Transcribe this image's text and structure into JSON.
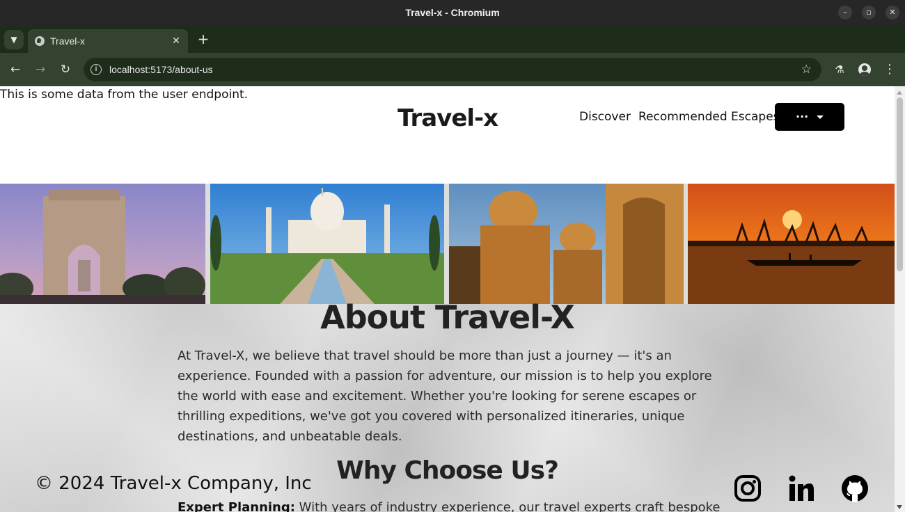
{
  "browser": {
    "window_title": "Travel-x - Chromium",
    "tab_title": "Travel-x",
    "url": "localhost:5173/about-us",
    "controls": {
      "minimize": "–",
      "maximize": "▫",
      "close": "✕",
      "tab_close": "✕",
      "new_tab": "+"
    }
  },
  "page": {
    "user_data": "This is some data from the user endpoint.",
    "logo": "Travel-x",
    "nav": {
      "discover": "Discover",
      "recommended": "Recommended Escapes",
      "more_button": "···"
    },
    "gallery": [
      {
        "name": "india-gate-photo"
      },
      {
        "name": "taj-mahal-photo"
      },
      {
        "name": "jaisalmer-cenotaphs-photo"
      },
      {
        "name": "kerala-backwaters-sunset-photo"
      }
    ],
    "about": {
      "title": "About Travel-X",
      "text": "At Travel-X, we believe that travel should be more than just a journey — it's an experience. Founded with a passion for adventure, our mission is to help you explore the world with ease and excitement. Whether you're looking for serene escapes or thrilling expeditions, we've got you covered with personalized itineraries, unique destinations, and unbeatable deals."
    },
    "why": {
      "title": "Why Choose Us?",
      "expert_label": "Expert Planning:",
      "expert_text": " With years of industry experience, our travel experts craft bespoke"
    },
    "footer": {
      "copyright": "© 2024 Travel-x Company, Inc",
      "social_icons": [
        "instagram-icon",
        "linkedin-icon",
        "github-icon"
      ]
    }
  },
  "colors": {
    "titlebar": "#272727",
    "tabstrip": "#1d2d1a",
    "toolbar": "#34432f",
    "paper": "#d4d4d4",
    "button": "#000000"
  }
}
